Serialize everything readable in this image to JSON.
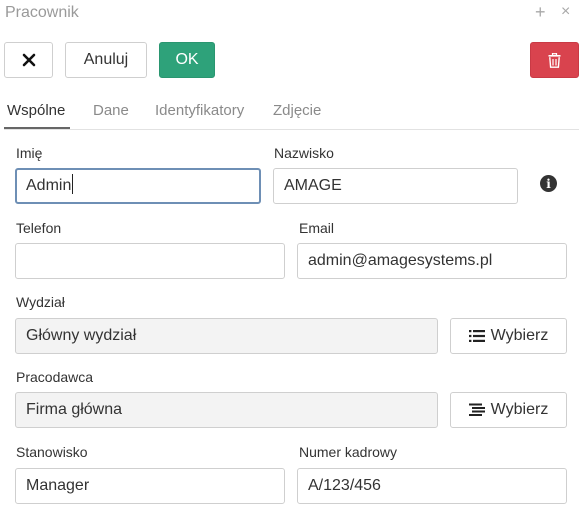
{
  "window": {
    "title": "Pracownik",
    "plus_glyph": "+",
    "close_glyph": "×"
  },
  "toolbar": {
    "anuluj_label": "Anuluj",
    "ok_label": "OK"
  },
  "tabs": [
    {
      "label": "Wspólne",
      "active": true
    },
    {
      "label": "Dane",
      "active": false
    },
    {
      "label": "Identyfikatory",
      "active": false
    },
    {
      "label": "Zdjęcie",
      "active": false
    }
  ],
  "form": {
    "imie": {
      "label": "Imię",
      "value": "Admin"
    },
    "nazwisko": {
      "label": "Nazwisko",
      "value": "AMAGE"
    },
    "telefon": {
      "label": "Telefon",
      "value": ""
    },
    "email": {
      "label": "Email",
      "value": "admin@amagesystems.pl"
    },
    "wydzial": {
      "label": "Wydział",
      "value": "Główny wydział",
      "button": "Wybierz"
    },
    "pracodawca": {
      "label": "Pracodawca",
      "value": "Firma główna",
      "button": "Wybierz"
    },
    "stanowisko": {
      "label": "Stanowisko",
      "value": "Manager"
    },
    "numer_kadrowy": {
      "label": "Numer kadrowy",
      "value": "A/123/456"
    }
  },
  "icons": {
    "close": "close-icon",
    "delete": "trash-icon",
    "info": "info-icon",
    "list": "list-icon",
    "org": "org-list-icon"
  },
  "colors": {
    "ok": "#2ea27a",
    "delete": "#d9434e",
    "focus": "#6e8fb5"
  }
}
